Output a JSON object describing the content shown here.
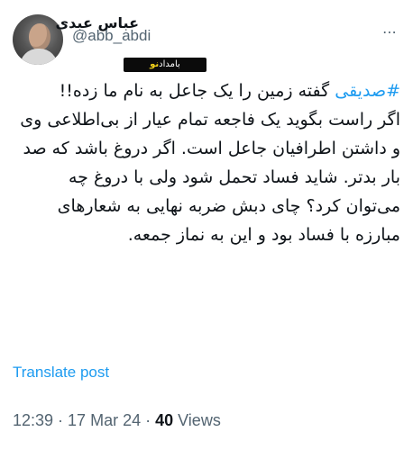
{
  "author": {
    "display_name": "عباس عبدی",
    "handle": "@abb_abdi"
  },
  "watermark": {
    "accent": "نو",
    "text": "بامداد"
  },
  "tweet": {
    "hashtag": "#صدیقی",
    "text": " گفته زمین را یک جاعل به نام ما زده!!\nاگر راست بگوید یک فاجعه تمام عیار از بی‌اطلاعی وی و داشتن اطرافیان جاعل است. اگر دروغ باشد که صد بار بدتر. شاید فساد تحمل شود ولی با دروغ چه می‌توان کرد؟ چای دبش ضربه نهایی به شعارهای مبارزه با فساد بود و این به نماز جمعه."
  },
  "translate_label": "Translate post",
  "meta": {
    "time": "12:39",
    "separator1": " · ",
    "date": "17 Mar 24",
    "separator2": " · ",
    "views_count": "40",
    "views_label": " Views"
  },
  "colors": {
    "link": "#1d9bf0",
    "secondary_text": "#536471",
    "primary_text": "#0f1419"
  },
  "icons": {
    "more": "more-icon"
  }
}
